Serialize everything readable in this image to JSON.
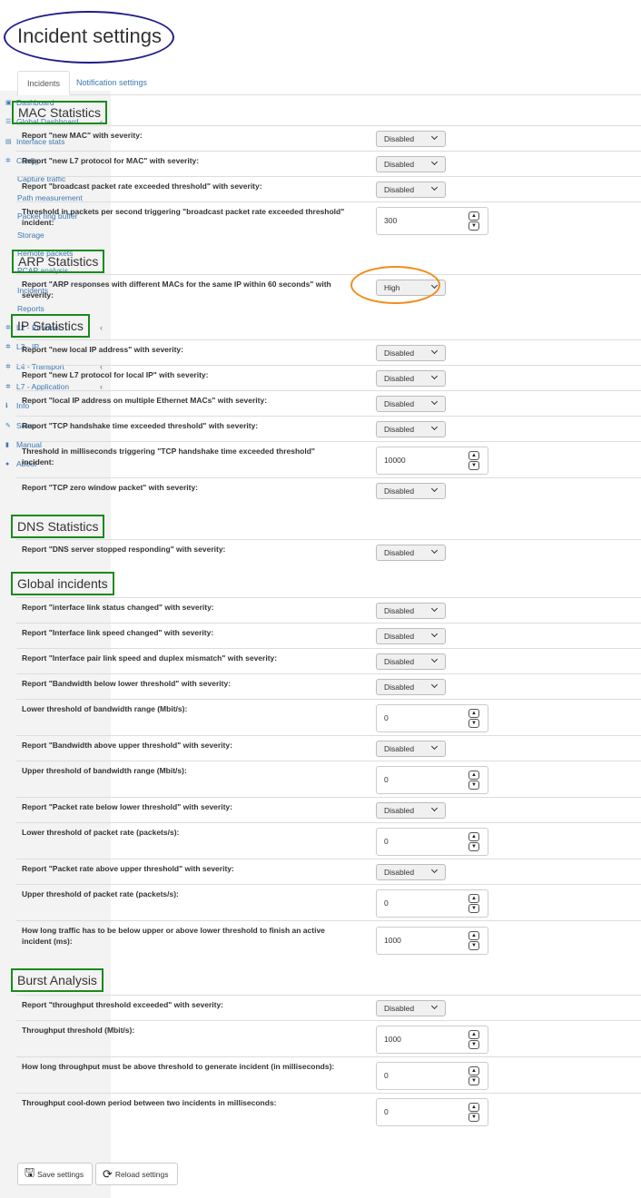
{
  "page": {
    "title": "Incident settings"
  },
  "tabs": [
    {
      "label": "Incidents"
    },
    {
      "label": "Notification settings"
    }
  ],
  "sidebar": {
    "items": [
      {
        "label": "Dashboard",
        "icon": "dashboard-icon"
      },
      {
        "label": "Global Dashboard",
        "icon": ""
      },
      {
        "label": "Interface stats",
        "icon": "chart-icon"
      },
      {
        "label": "Config",
        "icon": "gear-icon"
      },
      {
        "label": "Capture traffic",
        "icon": ""
      },
      {
        "label": "Path measurement",
        "icon": ""
      },
      {
        "label": "Packet ring buffer",
        "icon": ""
      },
      {
        "label": "Storage",
        "icon": ""
      },
      {
        "label": "Remote packets",
        "icon": ""
      },
      {
        "label": "PCAP analysis",
        "icon": ""
      },
      {
        "label": "Incidents",
        "icon": ""
      },
      {
        "label": "Reports",
        "icon": ""
      },
      {
        "label": "L2 - Ethernet",
        "icon": ""
      },
      {
        "label": "L3 - IP",
        "icon": "gear-icon"
      },
      {
        "label": "L4 - Transport",
        "icon": "gear-icon"
      },
      {
        "label": "L7 - Application",
        "icon": "gear-icon"
      },
      {
        "label": "Info",
        "icon": "info-icon"
      },
      {
        "label": "Setup",
        "icon": "wrench-icon"
      },
      {
        "label": "Manual",
        "icon": "book-icon"
      },
      {
        "label": "About",
        "icon": "info-circle-icon"
      }
    ]
  },
  "sections": {
    "mac": {
      "title": "MAC Statistics",
      "rows": [
        {
          "label": "Report \"new MAC\" with severity:",
          "value": "Disabled"
        },
        {
          "label": "Report \"new L7 protocol for MAC\" with severity:",
          "value": "Disabled"
        },
        {
          "label": "Report \"broadcast packet rate exceeded threshold\" with severity:",
          "value": "Disabled"
        },
        {
          "label": "Threshold in packets per second triggering \"broadcast packet rate exceeded threshold\" incident:",
          "value": "300"
        }
      ]
    },
    "arp": {
      "title": "ARP Statistics",
      "rows": [
        {
          "label": "Report \"ARP responses with different MACs for the same IP within 60 seconds\" with severity:",
          "value": "High"
        }
      ]
    },
    "ip": {
      "title": "IP Statistics",
      "rows": [
        {
          "label": "Report \"new local IP address\" with severity:",
          "value": "Disabled"
        },
        {
          "label": "Report \"new L7 protocol for local IP\" with severity:",
          "value": "Disabled"
        },
        {
          "label": "Report \"local IP address on multiple Ethernet MACs\" with severity:",
          "value": "Disabled"
        },
        {
          "label": "Report \"TCP handshake time exceeded threshold\" with severity:",
          "value": "Disabled"
        },
        {
          "label": "Threshold in milliseconds triggering \"TCP handshake time exceeded threshold\" incident:",
          "value": "10000"
        },
        {
          "label": "Report \"TCP zero window packet\" with severity:",
          "value": "Disabled"
        }
      ]
    },
    "dns": {
      "title": "DNS Statistics",
      "rows": [
        {
          "label": "Report \"DNS server stopped responding\" with severity:",
          "value": "Disabled"
        }
      ]
    },
    "global": {
      "title": "Global incidents",
      "rows": [
        {
          "label": "Report \"interface link status changed\" with severity:",
          "value": "Disabled"
        },
        {
          "label": "Report \"Interface link speed changed\" with severity:",
          "value": "Disabled"
        },
        {
          "label": "Report \"Interface pair link speed and duplex mismatch\" with severity:",
          "value": "Disabled"
        },
        {
          "label": "Report \"Bandwidth below lower threshold\" with severity:",
          "value": "Disabled"
        },
        {
          "label": "Lower threshold of bandwidth range (Mbit/s):",
          "value": "0"
        },
        {
          "label": "Report \"Bandwidth above upper threshold\" with severity:",
          "value": "Disabled"
        },
        {
          "label": "Upper threshold of bandwidth range (Mbit/s):",
          "value": "0"
        },
        {
          "label": "Report \"Packet rate below lower threshold\" with severity:",
          "value": "Disabled"
        },
        {
          "label": "Lower threshold of packet rate (packets/s):",
          "value": "0"
        },
        {
          "label": "Report \"Packet rate above upper threshold\" with severity:",
          "value": "Disabled"
        },
        {
          "label": "Upper threshold of packet rate (packets/s):",
          "value": "0"
        },
        {
          "label": "How long traffic has to be below upper or above lower threshold to finish an active incident (ms):",
          "value": "1000"
        }
      ]
    },
    "burst": {
      "title": "Burst Analysis",
      "rows": [
        {
          "label": "Report \"throughput threshold exceeded\" with severity:",
          "value": "Disabled"
        },
        {
          "label": "Throughput threshold (Mbit/s):",
          "value": "1000"
        },
        {
          "label": "How long throughput must be above threshold to generate incident (in milliseconds):",
          "value": "0"
        },
        {
          "label": "Throughput cool-down period between two incidents in milliseconds:",
          "value": "0"
        }
      ]
    }
  },
  "buttons": {
    "save": "Save settings",
    "reload": "Reload settings"
  },
  "colors": {
    "link": "#3c78b4",
    "section_highlight": "#1a8a1a",
    "title_highlight": "#1e1e8c",
    "value_highlight": "#f28c1e"
  }
}
